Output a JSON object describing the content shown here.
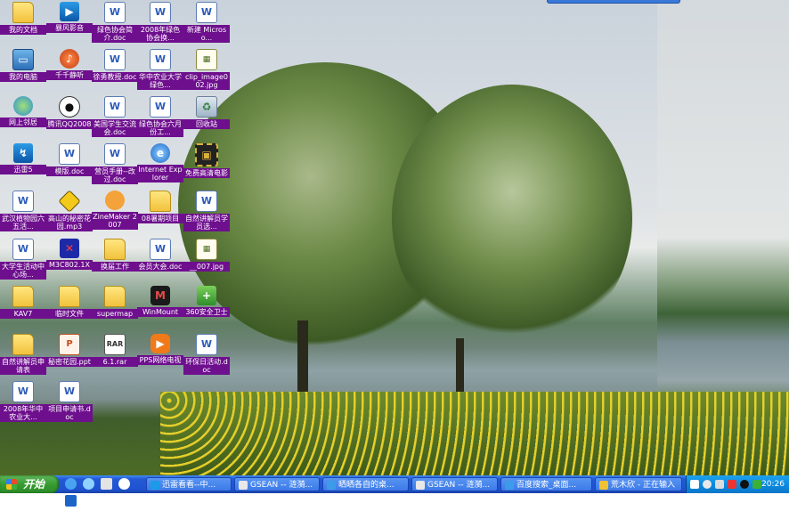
{
  "desktop_icons": [
    {
      "label": "我的文档",
      "glyph": "folder-icon",
      "style": "g-folder",
      "sym": ""
    },
    {
      "label": "暴风影音",
      "glyph": "storm-player-icon",
      "style": "g-blue",
      "sym": "▶"
    },
    {
      "label": "绿色协会简介.doc",
      "glyph": "word-doc-icon",
      "style": "g-doc",
      "sym": "W"
    },
    {
      "label": "2008年绿色协会换...",
      "glyph": "word-doc-icon",
      "style": "g-doc",
      "sym": "W"
    },
    {
      "label": "新建 Microso...",
      "glyph": "word-doc-icon",
      "style": "g-doc",
      "sym": "W"
    },
    {
      "label": "我的电脑",
      "glyph": "my-computer-icon",
      "style": "g-pc",
      "sym": "▭"
    },
    {
      "label": "千千静听",
      "glyph": "music-player-icon",
      "style": "g-red",
      "sym": "♪"
    },
    {
      "label": "徐勇教授.doc",
      "glyph": "word-doc-icon",
      "style": "g-doc",
      "sym": "W"
    },
    {
      "label": "华中农业大学绿色...",
      "glyph": "word-doc-icon",
      "style": "g-doc",
      "sym": "W"
    },
    {
      "label": "clip_image002.jpg",
      "glyph": "image-file-icon",
      "style": "g-jpg",
      "sym": "▦"
    },
    {
      "label": "网上邻居",
      "glyph": "network-icon",
      "style": "g-net",
      "sym": ""
    },
    {
      "label": "腾讯QQ2008",
      "glyph": "qq-penguin-icon",
      "style": "g-qq",
      "sym": "●"
    },
    {
      "label": "美国学生交流会.doc",
      "glyph": "word-doc-icon",
      "style": "g-doc",
      "sym": "W"
    },
    {
      "label": "绿色协会六月份工...",
      "glyph": "word-doc-icon",
      "style": "g-doc",
      "sym": "W"
    },
    {
      "label": "回收站",
      "glyph": "recycle-bin-icon",
      "style": "g-bin",
      "sym": "♻"
    },
    {
      "label": "迅雷5",
      "glyph": "thunder-icon",
      "style": "g-blue",
      "sym": "↯"
    },
    {
      "label": "模版.doc",
      "glyph": "word-doc-icon",
      "style": "g-doc",
      "sym": "W"
    },
    {
      "label": "营员手册--改过.doc",
      "glyph": "word-doc-icon",
      "style": "g-doc",
      "sym": "W"
    },
    {
      "label": "Internet Explorer",
      "glyph": "internet-explorer-icon",
      "style": "g-ie",
      "sym": "e"
    },
    {
      "label": "免费高清电影",
      "glyph": "film-icon",
      "style": "g-film",
      "sym": "▣"
    },
    {
      "label": "武汉植物园六五活...",
      "glyph": "word-doc-icon",
      "style": "g-doc",
      "sym": "W"
    },
    {
      "label": "高山的秘密花园.mp3",
      "glyph": "audio-file-icon",
      "style": "g-warn",
      "sym": ""
    },
    {
      "label": "ZineMaker 2007",
      "glyph": "zinemaker-icon",
      "style": "g-mm",
      "sym": ""
    },
    {
      "label": "08暑期项目",
      "glyph": "folder-icon",
      "style": "g-folder",
      "sym": ""
    },
    {
      "label": "自然讲解员学员选...",
      "glyph": "word-doc-icon",
      "style": "g-doc",
      "sym": "W"
    },
    {
      "label": "大学生活动中心场...",
      "glyph": "word-doc-icon",
      "style": "g-doc",
      "sym": "W"
    },
    {
      "label": "M3C802.1X",
      "glyph": "m3c-client-icon",
      "style": "g-m3c",
      "sym": "✕"
    },
    {
      "label": "换届工作",
      "glyph": "folder-icon",
      "style": "g-folder",
      "sym": ""
    },
    {
      "label": "会员大会.doc",
      "glyph": "word-doc-icon",
      "style": "g-doc",
      "sym": "W"
    },
    {
      "label": "__007.jpg",
      "glyph": "image-file-icon",
      "style": "g-jpg",
      "sym": "▦"
    },
    {
      "label": "KAV7",
      "glyph": "folder-icon",
      "style": "g-folder",
      "sym": ""
    },
    {
      "label": "临时文件",
      "glyph": "folder-icon",
      "style": "g-folder",
      "sym": ""
    },
    {
      "label": "supermap",
      "glyph": "folder-icon",
      "style": "g-folder",
      "sym": ""
    },
    {
      "label": "WinMount",
      "glyph": "winmount-icon",
      "style": "g-wm",
      "sym": "M"
    },
    {
      "label": "360安全卫士",
      "glyph": "shield-icon",
      "style": "g-green",
      "sym": "+"
    },
    {
      "label": "自然讲解员申请表",
      "glyph": "folder-icon",
      "style": "g-folder",
      "sym": ""
    },
    {
      "label": "秘密花园.ppt",
      "glyph": "powerpoint-icon",
      "style": "g-ppt",
      "sym": "P"
    },
    {
      "label": "6.1.rar",
      "glyph": "rar-archive-icon",
      "style": "g-rar",
      "sym": "RAR"
    },
    {
      "label": "PPS网络电视",
      "glyph": "pps-tv-icon",
      "style": "g-pps",
      "sym": "▶"
    },
    {
      "label": "环保日活动.doc",
      "glyph": "word-doc-icon",
      "style": "g-doc",
      "sym": "W"
    },
    {
      "label": "2008年华中农业大...",
      "glyph": "word-doc-icon",
      "style": "g-doc",
      "sym": "W"
    },
    {
      "label": "项目申请书.doc",
      "glyph": "word-doc-icon",
      "style": "g-doc",
      "sym": "W"
    }
  ],
  "taskbar": {
    "start_label": "开始",
    "tasks": [
      {
        "label": "迅雷看看--中...",
        "icon": "thunder-kankan-icon",
        "color": "#1b9be8"
      },
      {
        "label": "GSEAN -- 涟漪...",
        "icon": "chat-window-icon",
        "color": "#e8e8e8"
      },
      {
        "label": "晒晒各自的桌...",
        "icon": "browser-icon",
        "color": "#3d9be9"
      },
      {
        "label": "GSEAN -- 涟漪...",
        "icon": "chat-window-icon",
        "color": "#e8e8e8"
      },
      {
        "label": "百度搜索_桌面...",
        "icon": "browser-icon",
        "color": "#3d9be9"
      },
      {
        "label": "荒木欣 - 正在输入",
        "icon": "chat-window-icon",
        "color": "#f1c232"
      }
    ],
    "clock": "20:26"
  }
}
